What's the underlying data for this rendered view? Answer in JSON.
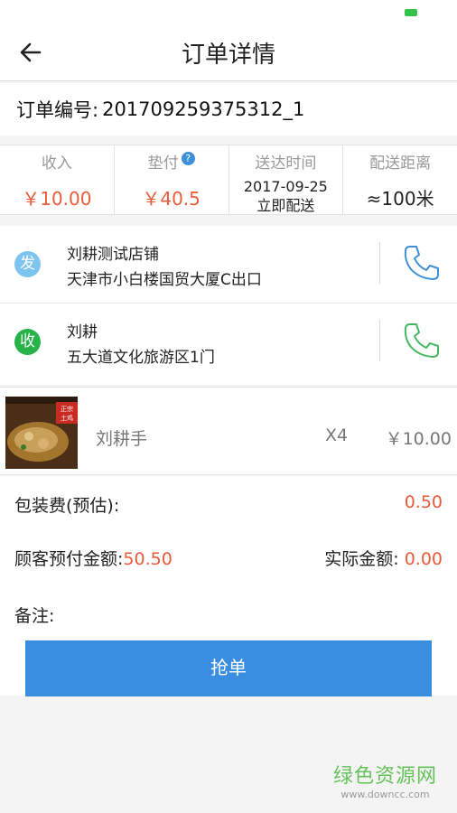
{
  "header": {
    "title": "订单详情"
  },
  "order": {
    "label": "订单编号:",
    "number": "201709259375312_1"
  },
  "stats": {
    "income": {
      "label": "收入",
      "value": "￥10.00"
    },
    "advance": {
      "label": "垫付",
      "value": "￥40.5",
      "help": "?"
    },
    "delivery_time": {
      "label": "送达时间",
      "date": "2017-09-25",
      "mode": "立即配送"
    },
    "distance": {
      "label": "配送距离",
      "value": "≈100米"
    }
  },
  "sender": {
    "badge": "发",
    "name": "刘耕测试店铺",
    "address": "天津市小白楼国贸大厦C出口",
    "phone_color": "#3f8fd8"
  },
  "receiver": {
    "badge": "收",
    "name": "刘耕",
    "address": "五大道文化旅游区1门",
    "phone_color": "#45b860"
  },
  "product": {
    "thumb_text": "正宗土鸡",
    "name": "刘耕手",
    "qty": "X4",
    "price": "￥10.00"
  },
  "fees": {
    "packing_label": "包装费(预估):",
    "packing_value": "0.50",
    "prepaid_label": "顾客预付金额:",
    "prepaid_value": "50.50",
    "actual_label": "实际金额:",
    "actual_value": "0.00",
    "note_label": "备注:"
  },
  "action": {
    "grab_label": "抢单"
  },
  "watermark": {
    "line1": "绿色资源网",
    "line2": "www.downcc.com"
  }
}
